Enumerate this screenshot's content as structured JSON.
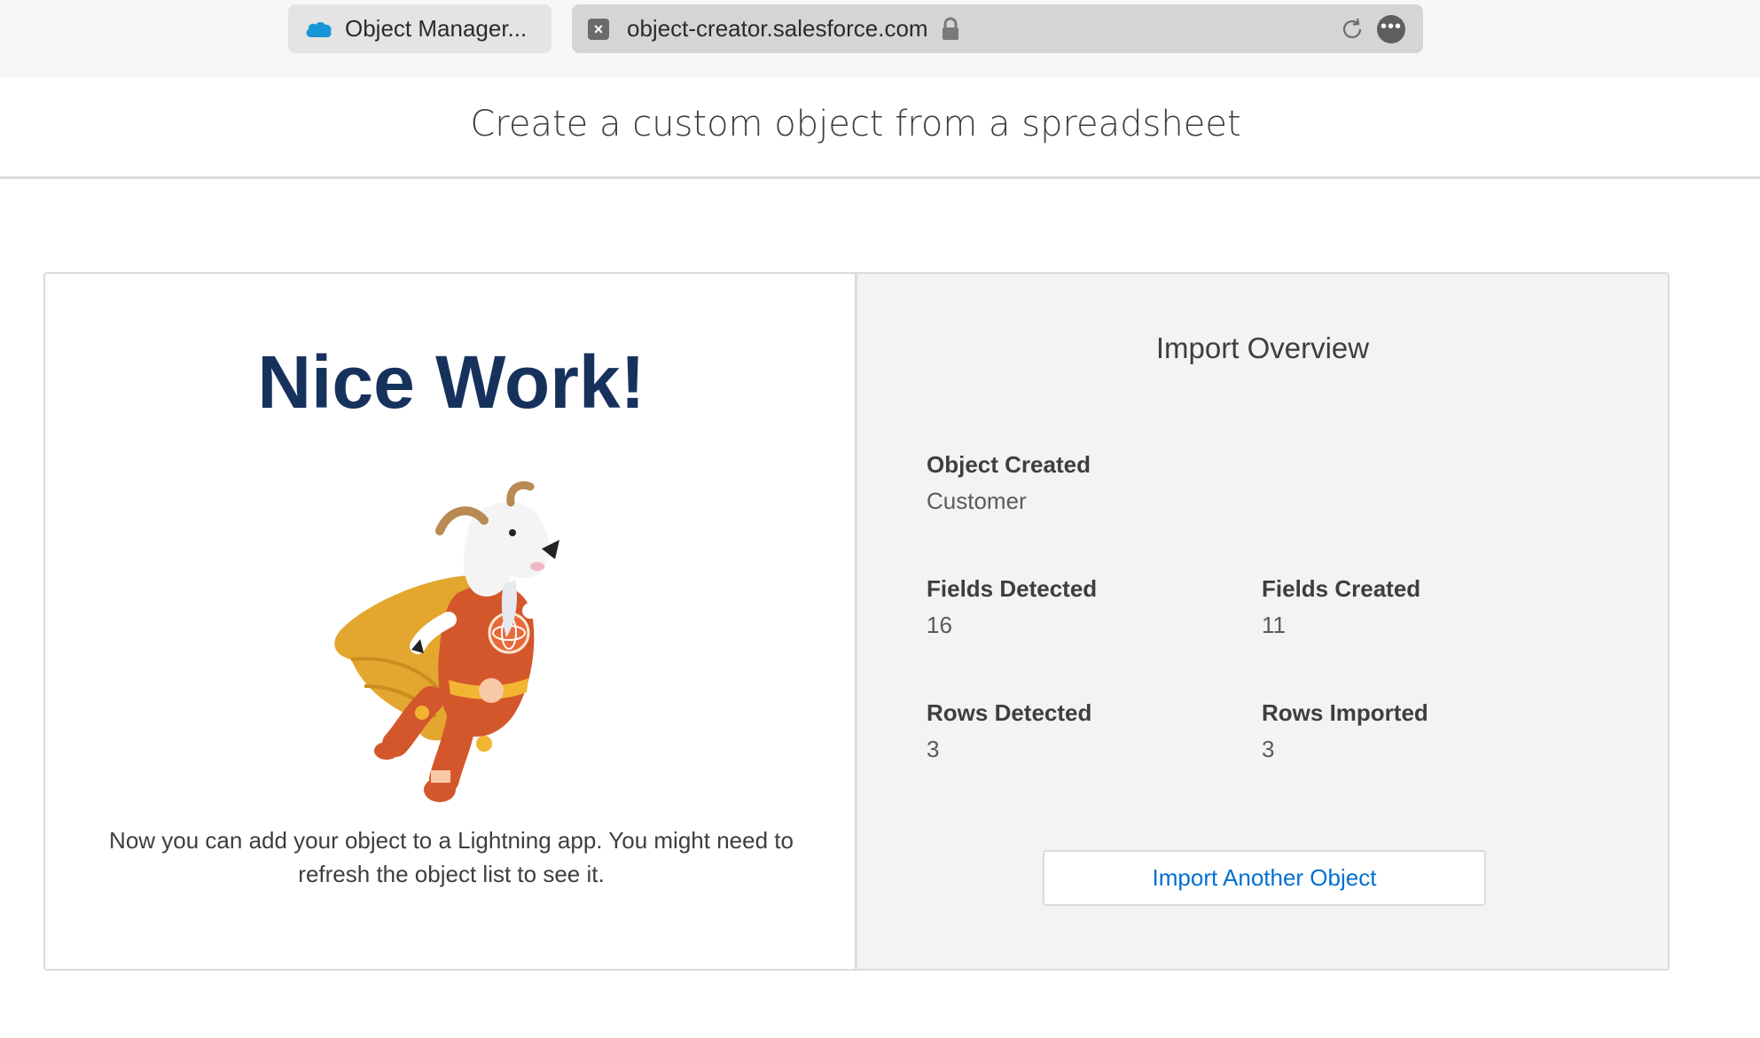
{
  "browser": {
    "tab_title": "Object Manager...",
    "url": "object-creator.salesforce.com",
    "icons": {
      "tab": "salesforce-cloud-icon",
      "site": "site-close-icon",
      "lock": "lock-icon",
      "reload": "reload-icon",
      "more": "more-icon"
    }
  },
  "header": {
    "title": "Create a custom object from a spreadsheet"
  },
  "success": {
    "heading": "Nice Work!",
    "illustration": "goat-superhero-mascot",
    "message": "Now you can add your object to a Lightning app. You might need to refresh the object list to see it."
  },
  "overview": {
    "title": "Import Overview",
    "object_created": {
      "label": "Object Created",
      "value": "Customer"
    },
    "fields_detected": {
      "label": "Fields Detected",
      "value": "16"
    },
    "fields_created": {
      "label": "Fields Created",
      "value": "11"
    },
    "rows_detected": {
      "label": "Rows Detected",
      "value": "3"
    },
    "rows_imported": {
      "label": "Rows Imported",
      "value": "3"
    },
    "button_label": "Import Another Object"
  },
  "colors": {
    "heading": "#16325c",
    "link": "#0070d2",
    "panel": "#f3f3f3",
    "border": "#dddbda"
  }
}
